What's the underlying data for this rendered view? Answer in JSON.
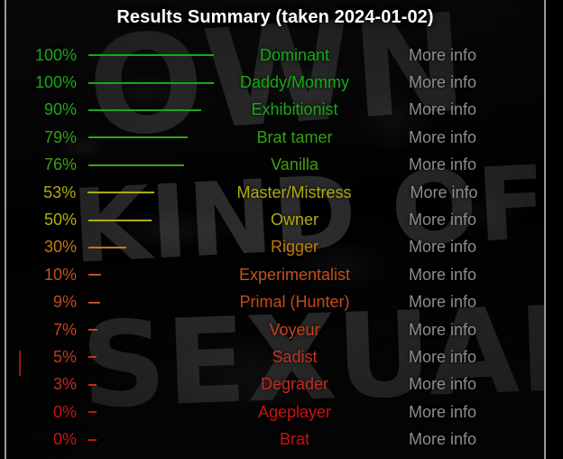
{
  "panel": {
    "title": "Results Summary (taken 2024-01-02)",
    "border_color": "#9a9a9a",
    "background_color": "#070707",
    "title_color": "#ffffff",
    "more_info_color": "#8d8d8d",
    "more_info_label": "More info",
    "side_tick_color": "#a01010"
  },
  "chart_data": {
    "type": "bar",
    "title": "Results Summary (taken 2024-01-02)",
    "xlabel": "",
    "ylabel": "",
    "xlim": [
      0,
      100
    ],
    "grid": false,
    "legend": "none",
    "orientation": "horizontal",
    "value_suffix": "%",
    "categories": [
      "Dominant",
      "Daddy/Mommy",
      "Exhibitionist",
      "Brat tamer",
      "Vanilla",
      "Master/Mistress",
      "Owner",
      "Rigger",
      "Experimentalist",
      "Primal (Hunter)",
      "Voyeur",
      "Sadist",
      "Degrader",
      "Ageplayer",
      "Brat"
    ],
    "values": [
      100,
      100,
      90,
      79,
      76,
      53,
      50,
      30,
      10,
      9,
      7,
      5,
      3,
      0,
      0
    ]
  },
  "rows": [
    {
      "percent": "100%",
      "value": 100,
      "label": "Dominant",
      "color": "#12ac12",
      "more_info": "More info"
    },
    {
      "percent": "100%",
      "value": 100,
      "label": "Daddy/Mommy",
      "color": "#12ac12",
      "more_info": "More info"
    },
    {
      "percent": "90%",
      "value": 90,
      "label": "Exhibitionist",
      "color": "#1ba81b",
      "more_info": "More info"
    },
    {
      "percent": "79%",
      "value": 79,
      "label": "Brat tamer",
      "color": "#35a113",
      "more_info": "More info"
    },
    {
      "percent": "76%",
      "value": 76,
      "label": "Vanilla",
      "color": "#42a012",
      "more_info": "More info"
    },
    {
      "percent": "53%",
      "value": 53,
      "label": "Master/Mistress",
      "color": "#adac0d",
      "more_info": "More info"
    },
    {
      "percent": "50%",
      "value": 50,
      "label": "Owner",
      "color": "#b5ab0c",
      "more_info": "More info"
    },
    {
      "percent": "30%",
      "value": 30,
      "label": "Rigger",
      "color": "#c07b0d",
      "more_info": "More info"
    },
    {
      "percent": "10%",
      "value": 10,
      "label": "Experimentalist",
      "color": "#c2521a",
      "more_info": "More info"
    },
    {
      "percent": "9%",
      "value": 9,
      "label": "Primal (Hunter)",
      "color": "#c34b1c",
      "more_info": "More info"
    },
    {
      "percent": "7%",
      "value": 7,
      "label": "Voyeur",
      "color": "#c4431d",
      "more_info": "More info"
    },
    {
      "percent": "5%",
      "value": 5,
      "label": "Sadist",
      "color": "#c43620",
      "more_info": "More info"
    },
    {
      "percent": "3%",
      "value": 3,
      "label": "Degrader",
      "color": "#c52c22",
      "more_info": "More info"
    },
    {
      "percent": "0%",
      "value": 0,
      "label": "Ageplayer",
      "color": "#cc1111",
      "more_info": "More info"
    },
    {
      "percent": "0%",
      "value": 0,
      "label": "Brat",
      "color": "#cc1111",
      "more_info": "More info"
    }
  ],
  "background": {
    "graffiti_words": [
      "OWN",
      "KIND OF",
      "SEXUAL"
    ]
  }
}
